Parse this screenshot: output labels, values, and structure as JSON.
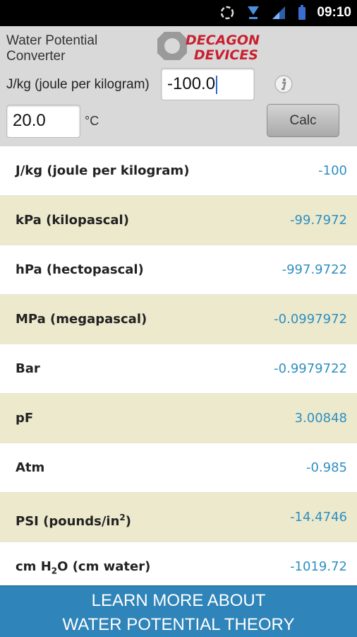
{
  "status_bar": {
    "time": "09:10"
  },
  "header": {
    "app_title_line1": "Water Potential",
    "app_title_line2": "Converter",
    "logo_line1": "DECAGON",
    "logo_line2": "DEVICES",
    "unit_label": "J/kg (joule per kilogram)",
    "value_input": "-100.0",
    "temperature_input": "20.0",
    "temperature_unit": "°C",
    "calc_label": "Calc"
  },
  "results": [
    {
      "name": "J/kg (joule per kilogram)",
      "value": "-100"
    },
    {
      "name": "kPa (kilopascal)",
      "value": "-99.7972"
    },
    {
      "name": "hPa (hectopascal)",
      "value": "-997.9722"
    },
    {
      "name": "MPa (megapascal)",
      "value": "-0.0997972"
    },
    {
      "name": "Bar",
      "value": "-0.9979722"
    },
    {
      "name": "pF",
      "value": "3.00848"
    },
    {
      "name": "Atm",
      "value": "-0.985"
    },
    {
      "name_prefix": "PSI (pounds/in",
      "name_sup": "2",
      "name_suffix": ")",
      "value": "-14.4746"
    },
    {
      "name_prefix": "cm H",
      "name_sub": "2",
      "name_suffix": "O (cm water)",
      "value": "-1019.72"
    }
  ],
  "banner": {
    "line1": "LEARN MORE ABOUT",
    "line2": "WATER POTENTIAL THEORY"
  },
  "colors": {
    "header_bg": "#d9d9d9",
    "row_alt_bg": "#ece9cc",
    "value_text": "#2f8fc2",
    "banner_bg": "#2f84b9",
    "logo_red": "#c8202f"
  }
}
